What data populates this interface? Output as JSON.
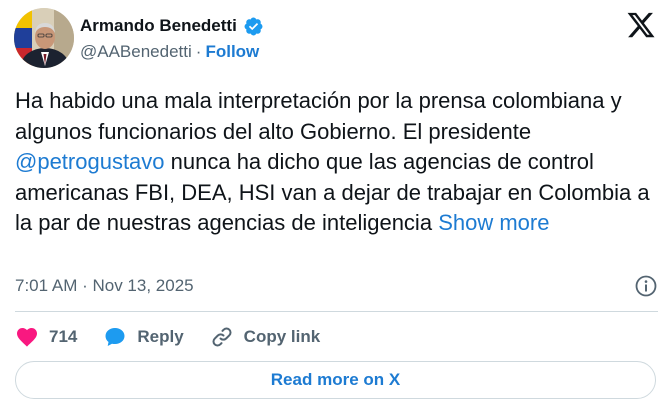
{
  "author": {
    "name": "Armando Benedetti",
    "handle": "@AABenedetti",
    "separator": "·",
    "follow_label": "Follow",
    "verified": true
  },
  "tweet": {
    "text_before_mention": "Ha habido una mala interpretación por la prensa colombiana y algunos funcionarios del alto Gobierno. El presidente ",
    "mention": "@petrogustavo",
    "text_after_mention": " nunca ha dicho que las agencias de control americanas FBI, DEA, HSI van a dejar de trabajar en Colombia a la par de nuestras agencias de inteligencia",
    "show_more_label": "Show more",
    "timestamp": "7:01 AM · Nov 13, 2025"
  },
  "actions": {
    "like_count": "714",
    "reply_label": "Reply",
    "copy_link_label": "Copy link"
  },
  "footer": {
    "read_more_label": "Read more on X"
  },
  "colors": {
    "accent": "#1d7bd2",
    "like": "#f91880",
    "secondary_text": "#536471",
    "border": "#cfd9de"
  },
  "icons": [
    "verified-badge-icon",
    "x-logo-icon",
    "info-icon",
    "heart-icon",
    "reply-bubble-icon",
    "link-icon"
  ]
}
